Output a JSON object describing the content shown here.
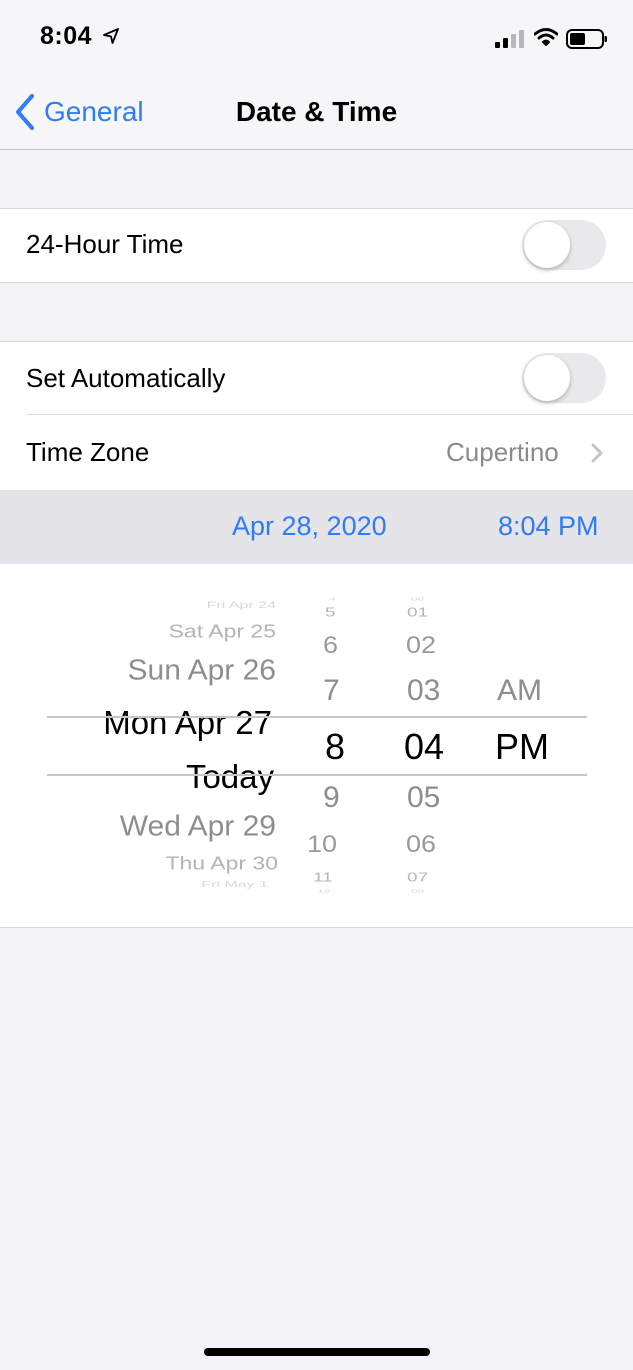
{
  "status_bar": {
    "time": "8:04"
  },
  "nav": {
    "back_label": "General",
    "title": "Date & Time"
  },
  "settings": {
    "hour24": {
      "label": "24-Hour Time",
      "enabled": false
    },
    "set_auto": {
      "label": "Set Automatically",
      "enabled": false
    },
    "time_zone": {
      "label": "Time Zone",
      "value": "Cupertino"
    }
  },
  "selected": {
    "date": "Apr 28, 2020",
    "time": "8:04 PM"
  },
  "picker": {
    "days": [
      "Fri Apr 24",
      "Sat Apr 25",
      "Sun Apr 26",
      "Mon Apr 27",
      "Today",
      "Wed Apr 29",
      "Thu Apr 30",
      "Fri May 1"
    ],
    "hours": [
      "4",
      "5",
      "6",
      "7",
      "8",
      "9",
      "10",
      "11",
      "12"
    ],
    "minutes": [
      "00",
      "01",
      "02",
      "03",
      "04",
      "05",
      "06",
      "07",
      "08"
    ],
    "ampm": [
      "AM",
      "PM"
    ]
  },
  "colors": {
    "accent": "#2f7cf6",
    "background": "#f2f2f7",
    "secondary_text": "#8a8a8e"
  },
  "icons": [
    "location-arrow-icon",
    "cellular-signal-icon",
    "wifi-icon",
    "battery-icon",
    "chevron-left-icon",
    "chevron-right-icon"
  ]
}
